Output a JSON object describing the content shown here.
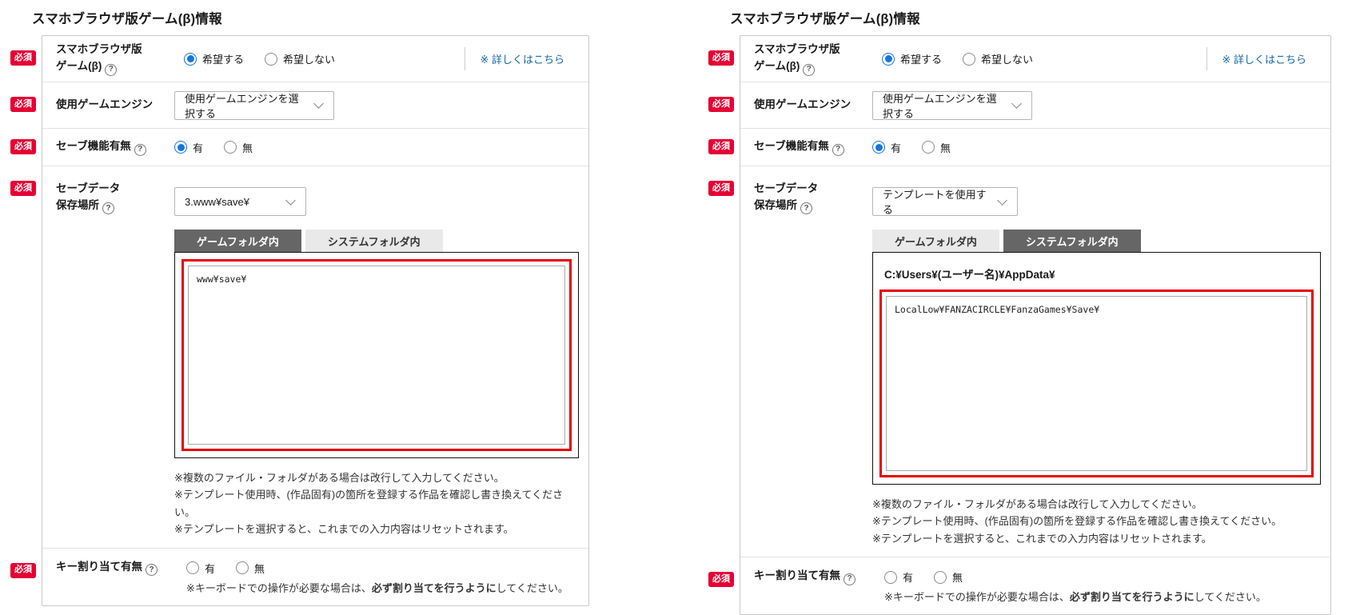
{
  "colors": {
    "required_badge": "#e60033",
    "radio_selected": "#1675e0",
    "link": "#1467a8",
    "highlight_border": "#e60000",
    "tab_active_bg": "#666666"
  },
  "icons": {
    "help_glyph": "?"
  },
  "left": {
    "title": "スマホブラウザ版ゲーム(β)情報",
    "rows": {
      "browser_game": {
        "required": "必須",
        "label_line1": "スマホブラウザ版",
        "label_line2": "ゲーム(β)",
        "options": [
          "希望する",
          "希望しない"
        ],
        "selected": "希望する",
        "detail_link": "※ 詳しくはこちら"
      },
      "engine": {
        "required": "必須",
        "label": "使用ゲームエンジン",
        "select_value": "使用ゲームエンジンを選択する"
      },
      "save_feature": {
        "required": "必須",
        "label": "セーブ機能有無",
        "options": [
          "有",
          "無"
        ],
        "selected": "有"
      },
      "save_location": {
        "required": "必須",
        "label_line1": "セーブデータ",
        "label_line2": "保存場所",
        "select_value": "3.www¥save¥",
        "tabs": [
          "ゲームフォルダ内",
          "システムフォルダ内"
        ],
        "active_tab": "ゲームフォルダ内",
        "textarea_value": "www¥save¥",
        "notes": [
          "※複数のファイル・フォルダがある場合は改行して入力してください。",
          "※テンプレート使用時、(作品固有)の箇所を登録する作品を確認し書き換えてください。",
          "※テンプレートを選択すると、これまでの入力内容はリセットされます。"
        ]
      },
      "key_assign": {
        "required": "必須",
        "label": "キー割り当て有無",
        "options": [
          "有",
          "無"
        ],
        "selected": "",
        "note_pre": "※キーボードでの操作が必要な場合は、",
        "note_bold": "必ず割り当てを行うように",
        "note_post": "してください。"
      }
    }
  },
  "right": {
    "title": "スマホブラウザ版ゲーム(β)情報",
    "rows": {
      "browser_game": {
        "required": "必須",
        "label_line1": "スマホブラウザ版",
        "label_line2": "ゲーム(β)",
        "options": [
          "希望する",
          "希望しない"
        ],
        "selected": "希望する",
        "detail_link": "※ 詳しくはこちら"
      },
      "engine": {
        "required": "必須",
        "label": "使用ゲームエンジン",
        "select_value": "使用ゲームエンジンを選択する"
      },
      "save_feature": {
        "required": "必須",
        "label": "セーブ機能有無",
        "options": [
          "有",
          "無"
        ],
        "selected": "有"
      },
      "save_location": {
        "required": "必須",
        "label_line1": "セーブデータ",
        "label_line2": "保存場所",
        "select_value": "テンプレートを使用する",
        "tabs": [
          "ゲームフォルダ内",
          "システムフォルダ内"
        ],
        "active_tab": "システムフォルダ内",
        "path_header": "C:¥Users¥(ユーザー名)¥AppData¥",
        "textarea_value": "LocalLow¥FANZACIRCLE¥FanzaGames¥Save¥",
        "notes": [
          "※複数のファイル・フォルダがある場合は改行して入力してください。",
          "※テンプレート使用時、(作品固有)の箇所を登録する作品を確認し書き換えてください。",
          "※テンプレートを選択すると、これまでの入力内容はリセットされます。"
        ]
      },
      "key_assign": {
        "required": "必須",
        "label": "キー割り当て有無",
        "options": [
          "有",
          "無"
        ],
        "selected": "",
        "note_pre": "※キーボードでの操作が必要な場合は、",
        "note_bold": "必ず割り当てを行うように",
        "note_post": "してください。"
      }
    }
  }
}
